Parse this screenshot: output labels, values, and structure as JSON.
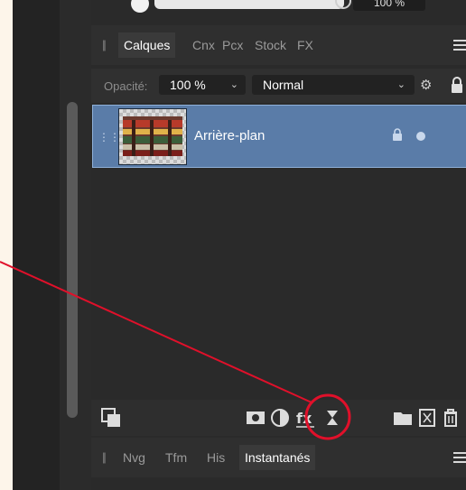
{
  "top": {
    "percent": "100 %"
  },
  "tabs": [
    "Calques",
    "Cnx",
    "Pcx",
    "Stock",
    "FX"
  ],
  "options": {
    "opacity_label": "Opacité:",
    "opacity_value": "100 %",
    "blend_mode": "Normal"
  },
  "layers": [
    {
      "name": "Arrière-plan"
    }
  ],
  "tabs2": [
    "Nvg",
    "Tfm",
    "His",
    "Instantanés"
  ],
  "colors": {
    "selection": "#5a7ca8",
    "annotation": "#e0102a"
  }
}
